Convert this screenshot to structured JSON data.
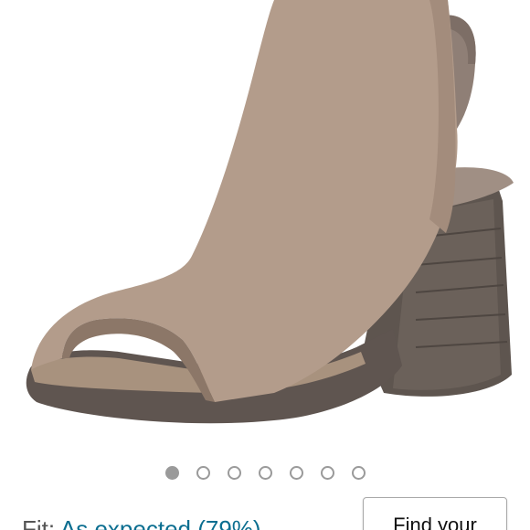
{
  "product": {
    "image_description_icon": "shoe-product-image"
  },
  "carousel": {
    "dot_count": 7,
    "active_index": 0
  },
  "fit": {
    "label": "Fit:",
    "value": "As expected (79%)"
  },
  "actions": {
    "find_size_label": "Find your"
  },
  "colors": {
    "link": "#0b6e90",
    "dot": "#9a9a9a"
  }
}
